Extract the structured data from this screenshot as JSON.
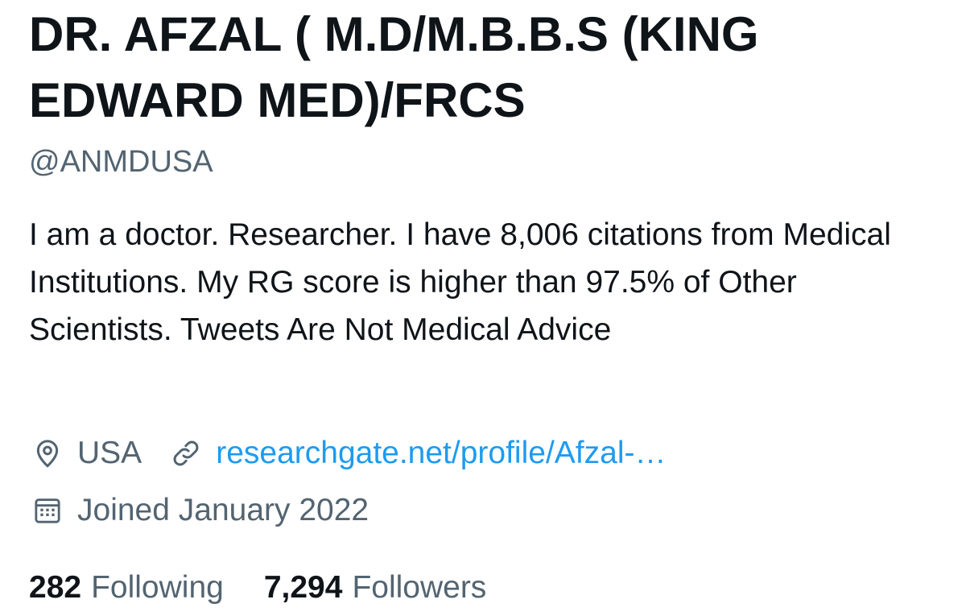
{
  "profile": {
    "display_name": "DR. AFZAL ( M.D/M.B.B.S (KING EDWARD MED)/FRCS",
    "handle": "@ANMDUSA",
    "bio": "I am a doctor. Researcher. I have 8,006 citations from Medical Institutions. My RG score is higher than 97.5% of Other Scientists. Tweets Are Not Medical Advice",
    "location": "USA",
    "website": "researchgate.net/profile/Afzal-…",
    "joined": "Joined January 2022"
  },
  "stats": {
    "following_count": "282",
    "following_label": "Following",
    "followers_count": "7,294",
    "followers_label": "Followers"
  },
  "icons": {
    "location": "location-pin-icon",
    "link": "link-icon",
    "calendar": "calendar-icon"
  },
  "colors": {
    "text_primary": "#0f1419",
    "text_secondary": "#536471",
    "link": "#1d9bf0",
    "background": "#ffffff"
  }
}
